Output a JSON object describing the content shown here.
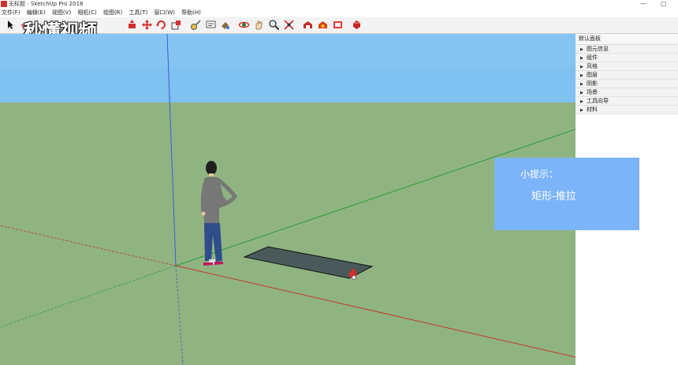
{
  "window": {
    "title": "无标题 - SketchUp Pro 2018"
  },
  "menu": [
    "文件(F)",
    "编辑(E)",
    "视图(V)",
    "相机(C)",
    "绘图(R)",
    "工具(T)",
    "窗口(W)",
    "帮助(H)"
  ],
  "watermark": "秒懂视频",
  "toolbar_icons": [
    "select-arrow-icon",
    "eraser-icon",
    "paint-bucket-icon",
    "line-pencil-icon",
    "rectangle-icon",
    "circle-icon",
    "arc-icon",
    "push-pull-icon",
    "move-icon",
    "rotate-icon",
    "scale-icon",
    "tape-measure-icon",
    "text-icon",
    "paint-icon",
    "orbit-icon",
    "pan-icon",
    "zoom-icon",
    "zoom-extents-icon",
    "warehouse-icon",
    "extension-warehouse-icon",
    "layout-icon",
    "ruby-icon"
  ],
  "tray": {
    "title": "默认面板",
    "items": [
      "图元信息",
      "组件",
      "风格",
      "图层",
      "阴影",
      "场景",
      "工具向导",
      "材料"
    ]
  },
  "hint": {
    "title": "小提示：",
    "body": "矩形-推拉"
  },
  "colors": {
    "sky": "#7fc1f0",
    "ground": "#8fb481",
    "hint_bg": "#7bb4f9",
    "accent": "#d32f2f"
  }
}
